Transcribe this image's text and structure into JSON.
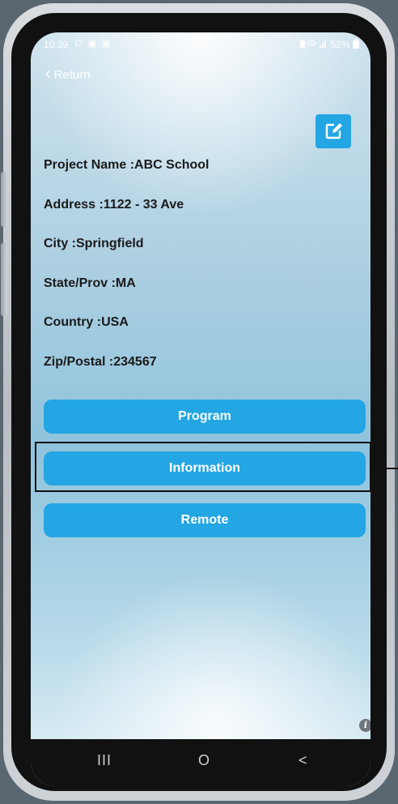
{
  "status_bar": {
    "time": "10:39",
    "left_icons": "∅ ▣ ▣ ·",
    "battery": "52%"
  },
  "nav": {
    "return_label": "Return"
  },
  "project": {
    "rows": [
      "Project Name :ABC School",
      "Address :1122 - 33 Ave",
      "City :Springfield",
      "State/Prov :MA",
      "Country :USA",
      "Zip/Postal :234567"
    ]
  },
  "actions": {
    "program_label": "Program",
    "information_label": "Information",
    "remote_label": "Remote"
  },
  "system_nav": {
    "recent": "III",
    "home": "O",
    "back": "<"
  },
  "info_icon": "i",
  "colors": {
    "accent": "#23a6e3",
    "highlight_border": "#111111"
  }
}
